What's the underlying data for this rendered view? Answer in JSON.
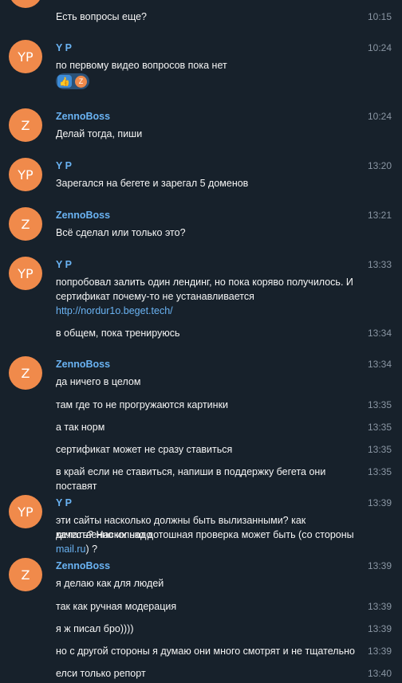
{
  "top_message": {
    "text": "Есть вопросы еще?",
    "time": "10:15"
  },
  "messages": [
    {
      "avatar": "YP",
      "name": "Y P",
      "time": "10:24",
      "text": "по первому видео вопросов пока нет",
      "reaction_emoji": "👍",
      "reaction_avatar": "Z"
    },
    {
      "avatar": "Z",
      "name": "ZennoBoss",
      "time": "10:24",
      "text": "Делай тогда, пиши"
    },
    {
      "avatar": "YP",
      "name": "Y P",
      "time": "13:20",
      "text": "Зарегался на бегете и зарегал 5 доменов"
    },
    {
      "avatar": "Z",
      "name": "ZennoBoss",
      "time": "13:21",
      "text": "Всё сделал или только это?"
    },
    {
      "avatar": "YP",
      "name": "Y P",
      "time": "13:33",
      "text_line1": "попробовал залить один лендинг, но пока коряво получилось. И",
      "text_line2": "сертификат почему-то не устанавливается",
      "link": "http://nordur1o.beget.tech/",
      "followup": {
        "text": "в общем, пока тренируюсь",
        "time": "13:34"
      }
    },
    {
      "avatar": "Z",
      "name": "ZennoBoss",
      "time": "13:34",
      "text": "да ничего в целом",
      "followups": [
        {
          "text": "там где то не прогружаются картинки",
          "time": "13:35"
        },
        {
          "text": "а так норм",
          "time": "13:35"
        },
        {
          "text": "сертификат может не сразу ставиться",
          "time": "13:35"
        },
        {
          "text": "в край если не ставиться, напиши в поддержку бегета они поставят",
          "time": "13:35"
        }
      ]
    },
    {
      "avatar": "YP",
      "name": "Y P",
      "time": "13:39",
      "text_line1": "эти сайты насколько должны быть вылизанными? как качественно их надо",
      "text_line2_pre": "делать? Насколько дотошная проверка может быть (со стороны ",
      "text_link": "mail.ru",
      "text_line2_post": ") ?"
    },
    {
      "avatar": "Z",
      "name": "ZennoBoss",
      "time": "13:39",
      "text": "я делаю как для людей",
      "followups": [
        {
          "text": "так как ручная модерация",
          "time": "13:39"
        },
        {
          "text": "я ж писал бро))))",
          "time": "13:39"
        },
        {
          "text": "но с другой стороны я думаю они много смотрят и не тщательно",
          "time": "13:39"
        },
        {
          "text": "елси только репорт",
          "time": "13:40"
        }
      ]
    }
  ]
}
